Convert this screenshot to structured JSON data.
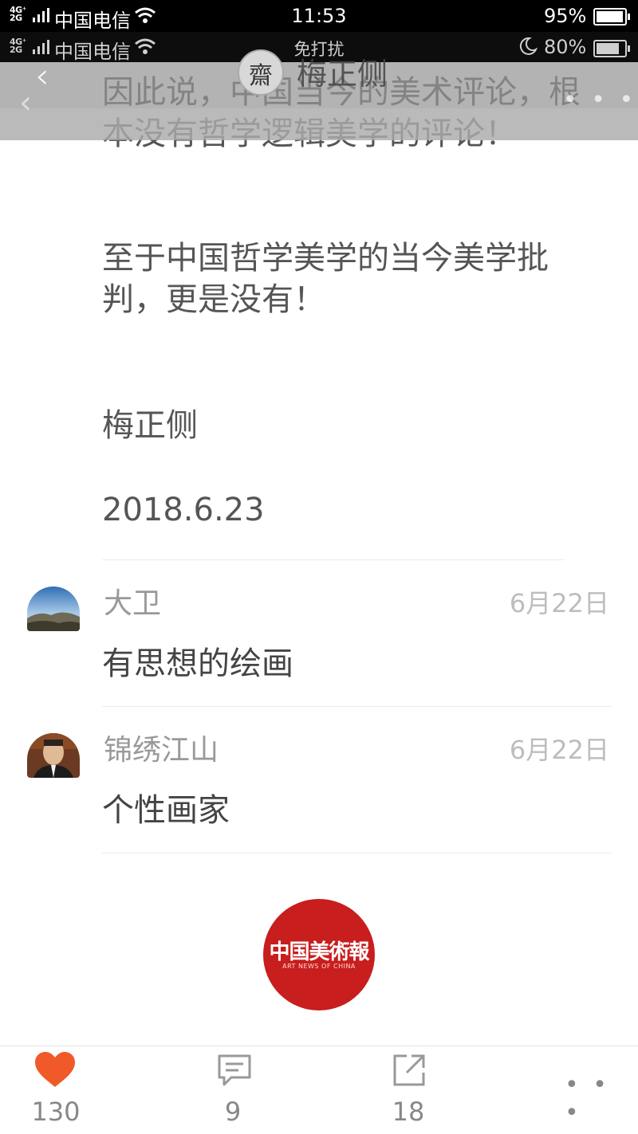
{
  "status_bar_primary": {
    "network": "4G⁺\n2G",
    "carrier": "中国电信",
    "time": "11:53",
    "battery_percent": "95%",
    "battery_level": 0.95
  },
  "status_bar_secondary": {
    "network": "4G⁺\n2G",
    "carrier": "中国电信",
    "center_text": "免打扰",
    "battery_percent": "80%",
    "battery_level": 0.8
  },
  "header": {
    "author_name": "梅正侧",
    "avatar_glyph": "齋"
  },
  "article": {
    "paragraph_1": "因此说，中国当今的美术评论，根本没有哲学逻辑美学的评论！",
    "paragraph_2": "至于中国哲学美学的当今美学批判，更是没有！",
    "signature": "梅正侧",
    "date": "2018.6.23"
  },
  "comments": [
    {
      "name": "大卫",
      "date": "6月22日",
      "text": "有思想的绘画"
    },
    {
      "name": "锦绣江山",
      "date": "6月22日",
      "text": "个性画家"
    }
  ],
  "publisher_logo": {
    "name": "中国美術報",
    "english": "ART NEWS OF CHINA"
  },
  "bottom_bar": {
    "likes": "130",
    "comments": "9",
    "shares": "18",
    "like_color": "#f05a28"
  }
}
